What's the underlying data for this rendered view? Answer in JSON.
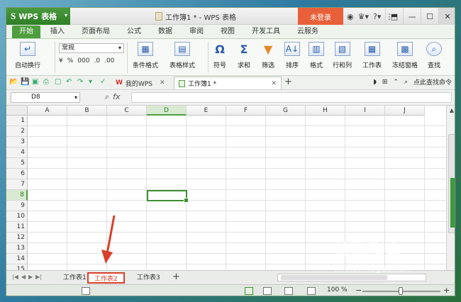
{
  "titlebar": {
    "app_name": "WPS 表格",
    "window_title": "工作簿1 * - WPS 表格",
    "login_label": "未登录"
  },
  "menu_tabs": [
    "开始",
    "插入",
    "页面布局",
    "公式",
    "数据",
    "审阅",
    "视图",
    "开发工具",
    "云服务"
  ],
  "ribbon": {
    "autowrap_label": "自动换行",
    "number_format": "常规",
    "format_symbols": [
      "¥",
      "%",
      "000",
      ".0",
      ".00"
    ],
    "buttons": {
      "cond_format": "条件格式",
      "table_style": "表格样式",
      "symbol": "符号",
      "sum": "求和",
      "filter": "筛选",
      "sort": "排序",
      "format": "格式",
      "row_col": "行和列",
      "worksheet": "工作表",
      "freeze": "冻结窗格",
      "find": "查找"
    }
  },
  "doc_tabs": {
    "mywps": "我的WPS",
    "book": "工作簿1 *",
    "search_hint": "点此查找命令"
  },
  "formula_bar": {
    "cell_ref": "D8",
    "fx_label": "fx",
    "value": ""
  },
  "grid": {
    "columns": [
      "A",
      "B",
      "C",
      "D",
      "E",
      "F",
      "G",
      "H",
      "I",
      "J"
    ],
    "rows": [
      "1",
      "2",
      "3",
      "4",
      "5",
      "6",
      "7",
      "8",
      "9",
      "10",
      "11",
      "12",
      "13",
      "14",
      "15"
    ],
    "active_col": "D",
    "active_row": "8"
  },
  "sheets": {
    "tabs": [
      "工作表1",
      "工作表2",
      "工作表3"
    ],
    "active": "工作表2",
    "add_label": "+"
  },
  "statusbar": {
    "zoom": "100 %"
  },
  "watermark": {
    "brand": "搜狗指南",
    "site": "zhinan.sogou.com"
  },
  "colors": {
    "accent": "#4e9e3e",
    "login": "#e8603a",
    "annotation": "#d8402c"
  }
}
